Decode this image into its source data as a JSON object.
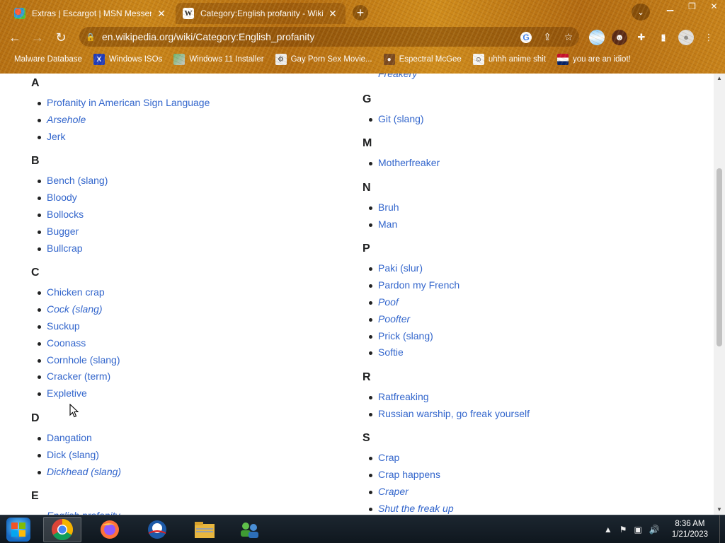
{
  "browser": {
    "tabs": [
      {
        "title": "Extras | Escargot | MSN Messeng",
        "icon": "escargot-icon",
        "active": false
      },
      {
        "title": "Category:English profanity - Wiki",
        "icon": "wikipedia-icon",
        "active": true
      }
    ],
    "new_tab": "+",
    "url": "en.wikipedia.org/wiki/Category:English_profanity",
    "bookmarks": [
      {
        "label": "Malware Database",
        "icon": "malware-icon"
      },
      {
        "label": "Windows ISOs",
        "icon": "x-icon"
      },
      {
        "label": "Windows 11 Installer",
        "icon": "win11-icon"
      },
      {
        "label": "Gay Porn Sex Movie...",
        "icon": "site-icon"
      },
      {
        "label": "Espectral McGee",
        "icon": "cat-icon"
      },
      {
        "label": "uhhh anime shit",
        "icon": "anime-icon"
      },
      {
        "label": "you are an idiot!",
        "icon": "flag-icon"
      }
    ]
  },
  "content": {
    "left_groups": [
      {
        "letter": "A",
        "items": [
          {
            "text": "Profanity in American Sign Language",
            "italic": false
          },
          {
            "text": "Arsehole",
            "italic": true
          },
          {
            "text": "Jerk",
            "italic": false
          }
        ]
      },
      {
        "letter": "B",
        "items": [
          {
            "text": "Bench (slang)",
            "italic": false
          },
          {
            "text": "Bloody",
            "italic": false
          },
          {
            "text": "Bollocks",
            "italic": false
          },
          {
            "text": "Bugger",
            "italic": false
          },
          {
            "text": "Bullcrap",
            "italic": false
          }
        ]
      },
      {
        "letter": "C",
        "items": [
          {
            "text": "Chicken crap",
            "italic": false
          },
          {
            "text": "Cock (slang)",
            "italic": true
          },
          {
            "text": "Suckup",
            "italic": false
          },
          {
            "text": "Coonass",
            "italic": false
          },
          {
            "text": "Cornhole (slang)",
            "italic": false
          },
          {
            "text": "Cracker (term)",
            "italic": false
          },
          {
            "text": "Expletive",
            "italic": false
          }
        ]
      },
      {
        "letter": "D",
        "items": [
          {
            "text": "Dangation",
            "italic": false
          },
          {
            "text": "Dick (slang)",
            "italic": false
          },
          {
            "text": "Dickhead (slang)",
            "italic": true
          }
        ]
      },
      {
        "letter": "E",
        "items": [
          {
            "text": "English profanity",
            "italic": true
          }
        ]
      }
    ],
    "right_top_item": {
      "text": "Freakery",
      "italic": true
    },
    "right_groups": [
      {
        "letter": "G",
        "items": [
          {
            "text": "Git (slang)",
            "italic": false
          }
        ]
      },
      {
        "letter": "M",
        "items": [
          {
            "text": "Motherfreaker",
            "italic": false
          }
        ]
      },
      {
        "letter": "N",
        "items": [
          {
            "text": "Bruh",
            "italic": false
          },
          {
            "text": "Man",
            "italic": false
          }
        ]
      },
      {
        "letter": "P",
        "items": [
          {
            "text": "Paki (slur)",
            "italic": false
          },
          {
            "text": "Pardon my French",
            "italic": false
          },
          {
            "text": "Poof",
            "italic": true
          },
          {
            "text": "Poofter",
            "italic": true
          },
          {
            "text": "Prick (slang)",
            "italic": false
          },
          {
            "text": "Softie",
            "italic": false
          }
        ]
      },
      {
        "letter": "R",
        "items": [
          {
            "text": "Ratfreaking",
            "italic": false
          },
          {
            "text": "Russian warship, go freak yourself",
            "italic": false
          }
        ]
      },
      {
        "letter": "S",
        "items": [
          {
            "text": "Crap",
            "italic": false
          },
          {
            "text": "Crap happens",
            "italic": false
          },
          {
            "text": "Craper",
            "italic": true
          },
          {
            "text": "Shut the freak up",
            "italic": true
          }
        ]
      }
    ]
  },
  "taskbar": {
    "apps": [
      "chrome-icon",
      "firefox-icon",
      "obama-icon",
      "file-explorer-icon",
      "network-users-icon"
    ],
    "time": "8:36 AM",
    "date": "1/21/2023"
  },
  "colors": {
    "link": "#3366cc",
    "text": "#202122",
    "chrome": "#c07a16"
  }
}
